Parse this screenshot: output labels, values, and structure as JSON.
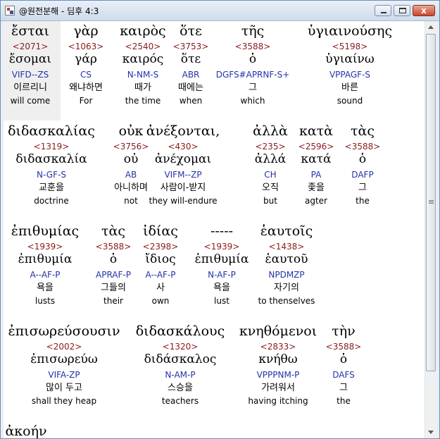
{
  "window": {
    "title": "@원전분해 - 딤후 4:3"
  },
  "icons": {
    "app": "app-icon",
    "minimize": "minimize-icon",
    "maximize": "maximize-icon",
    "close": "close-icon"
  },
  "close_glyph": "x",
  "rows": [
    {
      "words": [
        {
          "greek": "ἔσται",
          "strong": "<2071>",
          "lexeme": "ἔσομαι",
          "parse": "VIFD--ZS",
          "korean": "이르리니",
          "english": "will come"
        },
        {
          "greek": "γὰρ",
          "strong": "<1063>",
          "lexeme": "γάρ",
          "parse": "CS",
          "korean": "왜냐하면",
          "english": "For"
        },
        {
          "greek": "καιρὸς",
          "strong": "<2540>",
          "lexeme": "καιρός",
          "parse": "N-NM-S",
          "korean": "때가",
          "english": "the time"
        },
        {
          "greek": "ὅτε",
          "strong": "<3753>",
          "lexeme": "ὅτε",
          "parse": "ABR",
          "korean": "때에는",
          "english": "when"
        },
        {
          "greek": "τῆς",
          "strong": "<3588>",
          "lexeme": "ὁ",
          "parse": "DGFS#APRNF-S+",
          "korean": "그",
          "english": "which"
        },
        {
          "greek": "ὑγιαινούσης",
          "strong": "<5198>",
          "lexeme": "ὑγιαίνω",
          "parse": "VPPAGF-S",
          "korean": "바른",
          "english": "sound"
        }
      ]
    },
    {
      "words": [
        {
          "greek": "διδασκαλίας",
          "strong": "<1319>",
          "lexeme": "διδασκαλία",
          "parse": "N-GF-S",
          "korean": "교훈을",
          "english": "doctrine"
        },
        {
          "greek": "οὐκ",
          "strong": "<3756>",
          "lexeme": "οὐ",
          "parse": "AB",
          "korean": "아니하며",
          "english": "not"
        },
        {
          "greek": "ἀνέξονται,",
          "strong": "<430>",
          "lexeme": "ἀνέχομαι",
          "parse": "VIFM--ZP",
          "korean": "사람이-받지",
          "english": "they will-endure"
        },
        {
          "greek": "ἀλλὰ",
          "strong": "<235>",
          "lexeme": "ἀλλά",
          "parse": "CH",
          "korean": "오직",
          "english": "but"
        },
        {
          "greek": "κατὰ",
          "strong": "<2596>",
          "lexeme": "κατά",
          "parse": "PA",
          "korean": "좇을",
          "english": "agter"
        },
        {
          "greek": "τὰς",
          "strong": "<3588>",
          "lexeme": "ὁ",
          "parse": "DAFP",
          "korean": "그",
          "english": "the"
        }
      ]
    },
    {
      "words": [
        {
          "greek": "ἐπιθυμίας",
          "strong": "<1939>",
          "lexeme": "ἐπιθυμία",
          "parse": "A--AF-P",
          "korean": "욕을",
          "english": "lusts"
        },
        {
          "greek": "τὰς",
          "strong": "<3588>",
          "lexeme": "ὁ",
          "parse": "APRAF-P",
          "korean": "그들의",
          "english": "their"
        },
        {
          "greek": "ἰδίας",
          "strong": "<2398>",
          "lexeme": "ἴδιος",
          "parse": "A--AF-P",
          "korean": "사",
          "english": "own"
        },
        {
          "greek": "-----",
          "strong": "<1939>",
          "lexeme": "ἐπιθυμία",
          "parse": "N-AF-P",
          "korean": "욕을",
          "english": "lust"
        },
        {
          "greek": "ἑαυτοῖς",
          "strong": "<1438>",
          "lexeme": "ἑαυτοῦ",
          "parse": "NPDMZP",
          "korean": "자기의",
          "english": "to thenselves"
        }
      ]
    },
    {
      "words": [
        {
          "greek": "ἐπισωρεύσουσιν",
          "strong": "<2002>",
          "lexeme": "ἐπισωρεύω",
          "parse": "VIFA-ZP",
          "korean": "많이 두고",
          "english": "shall they heap"
        },
        {
          "greek": "διδασκάλους",
          "strong": "<1320>",
          "lexeme": "διδάσκαλος",
          "parse": "N-AM-P",
          "korean": "스승을",
          "english": "teachers"
        },
        {
          "greek": "κνηθόμενοι",
          "strong": "<2833>",
          "lexeme": "κνήθω",
          "parse": "VPPPNM-P",
          "korean": "가려워서",
          "english": "having itching"
        },
        {
          "greek": "τὴν",
          "strong": "<3588>",
          "lexeme": "ὁ",
          "parse": "DAFS",
          "korean": "그",
          "english": "the"
        }
      ]
    },
    {
      "words": [
        {
          "greek": "ἀκοήν",
          "strong": "",
          "lexeme": "",
          "parse": "",
          "korean": "",
          "english": ""
        }
      ]
    }
  ]
}
